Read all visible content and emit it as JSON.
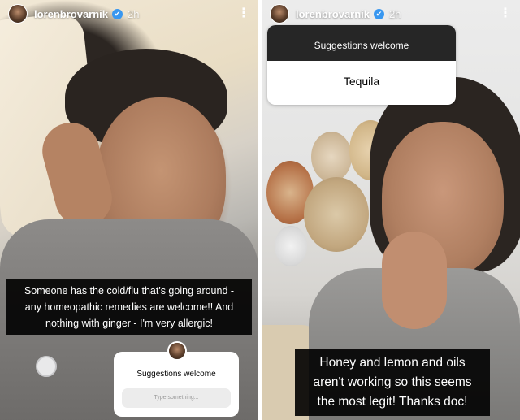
{
  "stories": [
    {
      "header": {
        "username": "lorenbrovarnik",
        "time": "2h",
        "verified_glyph": "✔",
        "more_glyph": "⋮"
      },
      "caption": [
        "Someone has the cold/flu that's going around -",
        "any homeopathic remedies are welcome!! And",
        "nothing with ginger - I'm very allergic!"
      ],
      "question_sticker": {
        "title": "Suggestions welcome",
        "placeholder": "Type something..."
      }
    },
    {
      "header": {
        "username": "lorenbrovarnik",
        "time": "2h",
        "verified_glyph": "✔",
        "more_glyph": "⋮"
      },
      "question_sticker": {
        "title": "Suggestions welcome",
        "answer": "Tequila"
      },
      "caption": [
        "Honey and lemon and oils",
        "aren't working so this seems",
        "the most legit! Thanks doc!"
      ]
    }
  ],
  "icons": {
    "verified": "verified-badge-icon",
    "more": "more-options-icon"
  },
  "colors": {
    "verified_blue": "#3897f0",
    "caption_bg": "#000000",
    "sticker_dark": "#262626"
  }
}
